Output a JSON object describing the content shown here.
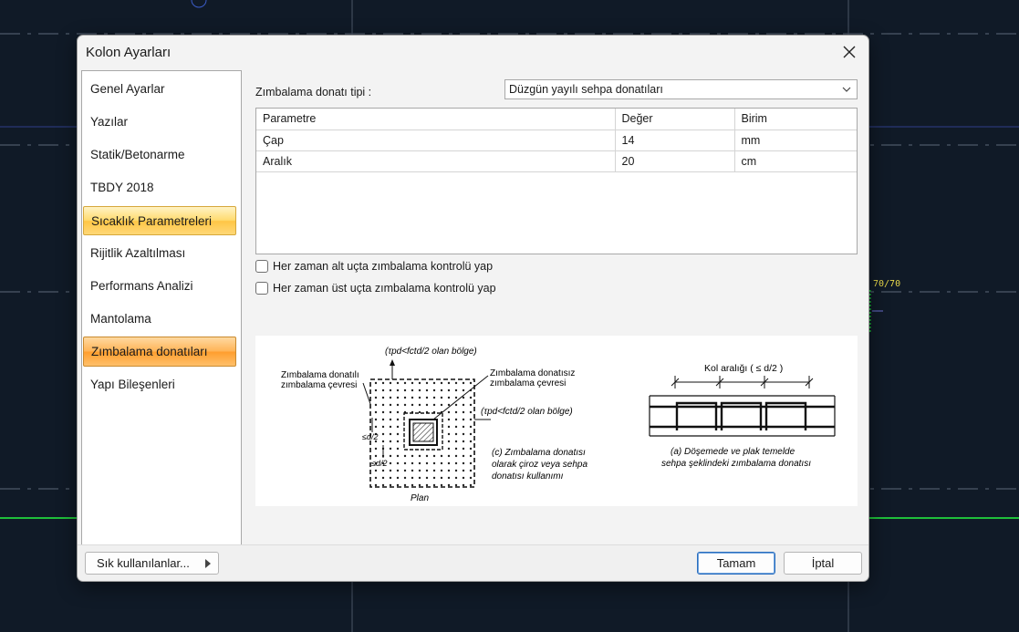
{
  "background": {
    "column_label": "70/70"
  },
  "dialog": {
    "title": "Kolon Ayarları",
    "close_icon": "close-icon"
  },
  "nav": {
    "items": [
      {
        "label": "Genel Ayarlar",
        "state": "normal"
      },
      {
        "label": "Yazılar",
        "state": "normal"
      },
      {
        "label": "Statik/Betonarme",
        "state": "normal"
      },
      {
        "label": "TBDY 2018",
        "state": "normal"
      },
      {
        "label": "Sıcaklık Parametreleri",
        "state": "hover"
      },
      {
        "label": "Rijitlik Azaltılması",
        "state": "normal"
      },
      {
        "label": "Performans Analizi",
        "state": "normal"
      },
      {
        "label": "Mantolama",
        "state": "normal"
      },
      {
        "label": "Zımbalama donatıları",
        "state": "selected"
      },
      {
        "label": "Yapı Bileşenleri",
        "state": "normal"
      }
    ]
  },
  "panel": {
    "type_label": "Zımbalama donatı tipi :",
    "type_value": "Düzgün yayılı sehpa donatıları",
    "table": {
      "headers": [
        "Parametre",
        "Değer",
        "Birim"
      ],
      "rows": [
        [
          "Çap",
          "14",
          "mm"
        ],
        [
          "Aralık",
          "20",
          "cm"
        ]
      ]
    },
    "checkboxes": [
      {
        "label": "Her zaman alt uçta zımbalama kontrolü yap",
        "checked": false
      },
      {
        "label": "Her zaman üst uçta zımbalama kontrolü yap",
        "checked": false
      }
    ],
    "figure": {
      "top_region": "(τpd<fctd/2 olan bölge)",
      "right_region": "(τpd<fctd/2 olan bölge)",
      "left_label_1": "Zımbalama donatılı",
      "left_label_2": "zımbalama çevresi",
      "mid_label_1": "Zımbalama donatısız",
      "mid_label_2": "zımbalama çevresi",
      "dim_1": "≤d/2",
      "dim_2": "≤d/2",
      "caption_c_1": "(c) Zımbalama donatısı",
      "caption_c_2": "olarak çiroz veya sehpa",
      "caption_c_3": "donatısı kullanımı",
      "plan_label": "Plan",
      "spacing_label": "Kol aralığı ( ≤ d/2 )",
      "caption_a_1": "(a) Döşemede ve plak temelde",
      "caption_a_2": "sehpa şeklindeki zımbalama donatısı"
    }
  },
  "buttons": {
    "favorites": "Sık kullanılanlar...",
    "ok": "Tamam",
    "cancel": "İptal"
  },
  "colors": {
    "cad_background": "#101a27",
    "selected_item": "#ffb458",
    "hover_item": "#ffdb70",
    "primary_border": "#2a6fbf"
  }
}
